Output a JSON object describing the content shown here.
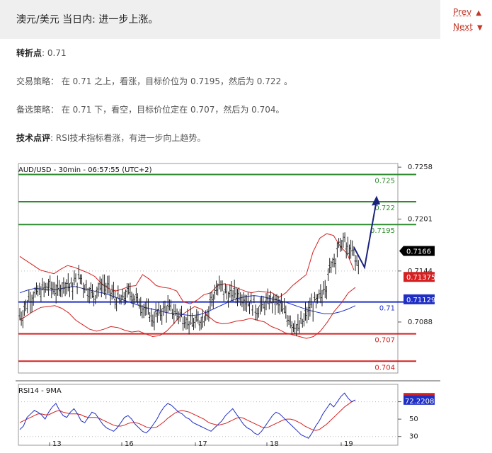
{
  "header": {
    "title": "澳元/美元 当日内: 进一步上涨。"
  },
  "nav": {
    "prev_label": "Prev",
    "next_label": "Next"
  },
  "content": {
    "pivot_label": "转折点",
    "pivot_value": ": 0.71",
    "strategy_label": "交易策略",
    "strategy_text": "：  在 0.71 之上，看涨，目标价位为 0.7195，然后为 0.722 。",
    "alt_label": "备选策略",
    "alt_text": "：  在 0.71 下，看空，目标价位定在 0.707，然后为 0.704。",
    "comment_label": "技术点评",
    "comment_text": ": RSI技术指标看涨，有进一步向上趋势。"
  },
  "chart_data": {
    "type": "line",
    "title": "AUD/USD - 30min - 06:57:55 (UTC+2)",
    "x_tick_labels": [
      "13",
      "16",
      "17",
      "18",
      "19"
    ],
    "y_tick_labels": [
      "0.7258",
      "0.7201",
      "0.7144",
      "0.7088"
    ],
    "ylim": [
      0.7032,
      0.7262
    ],
    "current_price": "0.7166",
    "upper_band_value": "0.71375",
    "ma_value": "0.71129",
    "levels": [
      {
        "label": "0.725",
        "value": 0.725,
        "color": "#2e8b2e"
      },
      {
        "label": "0.722",
        "value": 0.722,
        "color": "#2e8b2e"
      },
      {
        "label": "0.7195",
        "value": 0.7195,
        "color": "#2e8b2e"
      },
      {
        "label": "0.71",
        "value": 0.711,
        "color": "#1f2fc4"
      },
      {
        "label": "0.707",
        "value": 0.7075,
        "color": "#d42020"
      },
      {
        "label": "0.704",
        "value": 0.7045,
        "color": "#d42020"
      }
    ],
    "price_series": [
      0.7095,
      0.7106,
      0.7115,
      0.7118,
      0.7121,
      0.7124,
      0.7127,
      0.7125,
      0.7122,
      0.7128,
      0.7131,
      0.7126,
      0.7132,
      0.7136,
      0.7128,
      0.7122,
      0.7118,
      0.7125,
      0.7129,
      0.7124,
      0.7119,
      0.7113,
      0.7111,
      0.7117,
      0.7121,
      0.7115,
      0.711,
      0.7104,
      0.7098,
      0.7092,
      0.7096,
      0.71,
      0.7103,
      0.7101,
      0.7098,
      0.7096,
      0.7092,
      0.7089,
      0.7086,
      0.7088,
      0.7093,
      0.71,
      0.7113,
      0.7123,
      0.7126,
      0.7121,
      0.7117,
      0.712,
      0.7118,
      0.7115,
      0.7111,
      0.7107,
      0.7102,
      0.7105,
      0.7108,
      0.7112,
      0.711,
      0.7106,
      0.7099,
      0.7093,
      0.7086,
      0.7081,
      0.7087,
      0.7097,
      0.7105,
      0.7109,
      0.7115,
      0.7128,
      0.7145,
      0.7158,
      0.717,
      0.7176,
      0.7168,
      0.7164,
      0.7154
    ],
    "upper_band": [
      0.716,
      0.7155,
      0.715,
      0.7145,
      0.7143,
      0.7141,
      0.7146,
      0.715,
      0.7148,
      0.7145,
      0.7142,
      0.7138,
      0.713,
      0.7125,
      0.7122,
      0.7124,
      0.7127,
      0.7128,
      0.714,
      0.7135,
      0.7128,
      0.7126,
      0.7125,
      0.7122,
      0.711,
      0.7108,
      0.7112,
      0.7118,
      0.712,
      0.7128,
      0.713,
      0.7128,
      0.7125,
      0.7122,
      0.712,
      0.7122,
      0.7121,
      0.712,
      0.7115,
      0.712,
      0.7128,
      0.7134,
      0.714,
      0.7165,
      0.718,
      0.7185,
      0.7183,
      0.7171,
      0.7163,
      0.7145
    ],
    "lower_band": [
      0.709,
      0.7095,
      0.71,
      0.7104,
      0.7105,
      0.7106,
      0.7103,
      0.7098,
      0.709,
      0.7085,
      0.708,
      0.7078,
      0.708,
      0.7083,
      0.7082,
      0.7079,
      0.7077,
      0.7078,
      0.7075,
      0.7072,
      0.7073,
      0.7078,
      0.7086,
      0.7095,
      0.71,
      0.7105,
      0.7102,
      0.7094,
      0.7088,
      0.7086,
      0.7087,
      0.7089,
      0.709,
      0.7092,
      0.709,
      0.7088,
      0.7083,
      0.708,
      0.7076,
      0.7074,
      0.7072,
      0.707,
      0.7072,
      0.7078,
      0.7088,
      0.71,
      0.7109,
      0.712,
      0.7126
    ],
    "moving_average": [
      0.712,
      0.7123,
      0.7125,
      0.7124,
      0.7123,
      0.7124,
      0.7126,
      0.7127,
      0.7125,
      0.7123,
      0.7121,
      0.7119,
      0.7116,
      0.7113,
      0.711,
      0.7107,
      0.7104,
      0.7102,
      0.71,
      0.7098,
      0.7097,
      0.7096,
      0.7095,
      0.7096,
      0.7099,
      0.7103,
      0.7107,
      0.7111,
      0.7114,
      0.7116,
      0.7117,
      0.7116,
      0.7114,
      0.7112,
      0.711,
      0.7107,
      0.7104,
      0.7101,
      0.7099,
      0.7097,
      0.7097,
      0.7099,
      0.7102,
      0.7106
    ],
    "forecast_path": [
      0.717,
      0.7148,
      0.7222
    ],
    "rsi": {
      "label": "RSI14 - 9MA",
      "ticks": [
        "70",
        "50",
        "30"
      ],
      "value_rsi": "74.3616",
      "value_ma": "72.2208",
      "series": [
        38,
        42,
        52,
        56,
        60,
        58,
        55,
        50,
        58,
        64,
        68,
        60,
        54,
        52,
        58,
        62,
        56,
        48,
        46,
        52,
        58,
        56,
        50,
        44,
        40,
        38,
        36,
        40,
        46,
        52,
        54,
        50,
        44,
        40,
        36,
        34,
        38,
        44,
        50,
        58,
        64,
        68,
        66,
        62,
        58,
        56,
        52,
        50,
        46,
        44,
        42,
        40,
        38,
        36,
        40,
        44,
        48,
        54,
        58,
        62,
        56,
        50,
        44,
        40,
        38,
        34,
        32,
        36,
        42,
        48,
        54,
        58,
        56,
        52,
        48,
        44,
        40,
        36,
        32,
        30,
        28,
        34,
        42,
        48,
        56,
        62,
        68,
        64,
        70,
        76,
        80,
        74,
        70,
        72
      ],
      "ma": [
        46,
        48,
        50,
        52,
        54,
        56,
        56,
        55,
        55,
        57,
        59,
        60,
        58,
        57,
        56,
        56,
        56,
        55,
        53,
        52,
        52,
        52,
        51,
        49,
        47,
        45,
        43,
        42,
        42,
        43,
        45,
        46,
        46,
        45,
        43,
        41,
        40,
        40,
        41,
        44,
        47,
        51,
        54,
        57,
        59,
        60,
        59,
        58,
        56,
        54,
        52,
        50,
        47,
        45,
        44,
        43,
        44,
        45,
        47,
        49,
        51,
        52,
        51,
        49,
        47,
        45,
        43,
        41,
        40,
        41,
        43,
        45,
        47,
        49,
        50,
        50,
        49,
        47,
        45,
        42,
        40,
        38,
        37,
        38,
        41,
        44,
        48,
        52,
        56,
        60,
        64,
        67,
        70,
        72
      ]
    }
  }
}
